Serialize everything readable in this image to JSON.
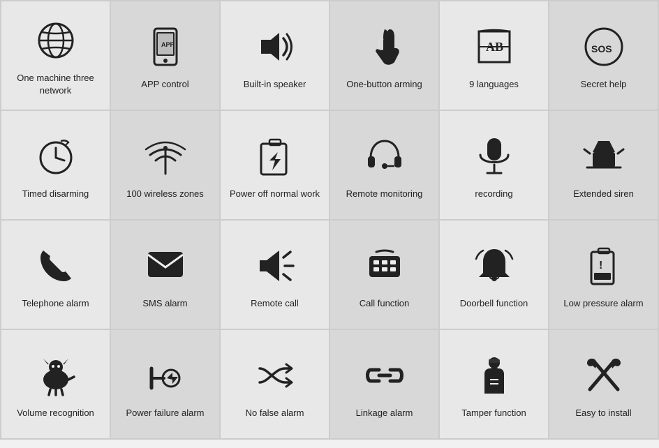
{
  "cells": [
    {
      "id": "one-machine",
      "label": "One machine three network",
      "bg": "light"
    },
    {
      "id": "app-control",
      "label": "APP control",
      "bg": "dark"
    },
    {
      "id": "builtin-speaker",
      "label": "Built-in speaker",
      "bg": "light"
    },
    {
      "id": "one-button",
      "label": "One-button arming",
      "bg": "dark"
    },
    {
      "id": "nine-languages",
      "label": "9 languages",
      "bg": "light"
    },
    {
      "id": "secret-help",
      "label": "Secret help",
      "bg": "dark"
    },
    {
      "id": "timed-disarming",
      "label": "Timed disarming",
      "bg": "dark"
    },
    {
      "id": "wireless-zones",
      "label": "100 wireless zones",
      "bg": "light"
    },
    {
      "id": "power-off",
      "label": "Power off normal work",
      "bg": "dark"
    },
    {
      "id": "remote-monitoring",
      "label": "Remote monitoring",
      "bg": "light"
    },
    {
      "id": "recording",
      "label": "recording",
      "bg": "dark"
    },
    {
      "id": "extended-siren",
      "label": "Extended siren",
      "bg": "light"
    },
    {
      "id": "telephone-alarm",
      "label": "Telephone alarm",
      "bg": "light"
    },
    {
      "id": "sms-alarm",
      "label": "SMS alarm",
      "bg": "dark"
    },
    {
      "id": "remote-call",
      "label": "Remote call",
      "bg": "light"
    },
    {
      "id": "call-function",
      "label": "Call function",
      "bg": "dark"
    },
    {
      "id": "doorbell-function",
      "label": "Doorbell function",
      "bg": "light"
    },
    {
      "id": "low-pressure",
      "label": "Low pressure alarm",
      "bg": "dark"
    },
    {
      "id": "volume-recognition",
      "label": "Volume recognition",
      "bg": "dark"
    },
    {
      "id": "power-failure",
      "label": "Power failure alarm",
      "bg": "light"
    },
    {
      "id": "no-false-alarm",
      "label": "No false alarm",
      "bg": "dark"
    },
    {
      "id": "linkage-alarm",
      "label": "Linkage alarm",
      "bg": "light"
    },
    {
      "id": "tamper-function",
      "label": "Tamper function",
      "bg": "dark"
    },
    {
      "id": "easy-install",
      "label": "Easy to install",
      "bg": "light"
    }
  ]
}
